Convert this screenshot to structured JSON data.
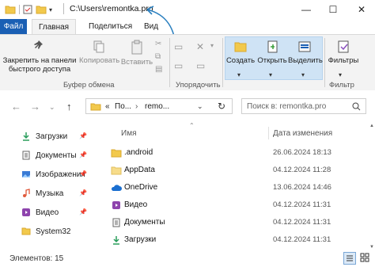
{
  "titlebar": {
    "path": "C:\\Users\\remontka.pro",
    "minimize": "—",
    "maximize": "☐",
    "close": "✕"
  },
  "ribbon_tabs": [
    "Файл",
    "Главная",
    "Поделиться",
    "Вид"
  ],
  "ribbon": {
    "pin_label": "Закрепить на панели быстрого доступа",
    "copy_label": "Копировать",
    "paste_label": "Вставить",
    "clipboard_group": "Буфер обмена",
    "organize_group": "Упорядочить",
    "create_label": "Создать",
    "open_label": "Открыть",
    "select_label": "Выделить",
    "filters_label": "Фильтры",
    "filter_group": "Фильтр"
  },
  "navigation": {
    "address_crumbs": [
      "«",
      "По...",
      "›",
      "remo..."
    ],
    "search_placeholder": "Поиск в: remontka.pro"
  },
  "sidebar": {
    "items": [
      {
        "label": "Загрузки",
        "icon": "download-icon"
      },
      {
        "label": "Документы",
        "icon": "documents-icon"
      },
      {
        "label": "Изображения",
        "icon": "pictures-icon"
      },
      {
        "label": "Музыка",
        "icon": "music-icon"
      },
      {
        "label": "Видео",
        "icon": "video-icon"
      },
      {
        "label": "System32",
        "icon": "folder-icon"
      }
    ]
  },
  "file_list": {
    "columns": {
      "name": "Имя",
      "date": "Дата изменения"
    },
    "rows": [
      {
        "name": ".android",
        "date": "26.06.2024 18:13",
        "icon": "folder-icon"
      },
      {
        "name": "AppData",
        "date": "04.12.2024 11:28",
        "icon": "folder-icon"
      },
      {
        "name": "OneDrive",
        "date": "13.06.2024 14:46",
        "icon": "cloud-icon"
      },
      {
        "name": "Видео",
        "date": "04.12.2024 11:31",
        "icon": "video-icon"
      },
      {
        "name": "Документы",
        "date": "04.12.2024 11:31",
        "icon": "documents-icon"
      },
      {
        "name": "Загрузки",
        "date": "04.12.2024 11:31",
        "icon": "download-icon"
      }
    ]
  },
  "status": {
    "items_count": "Элементов: 15"
  }
}
